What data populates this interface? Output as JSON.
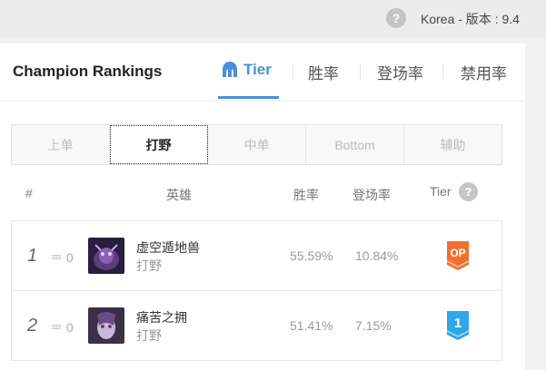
{
  "topbar": {
    "help_icon": "question-circle-icon",
    "region_text": "Korea - 版本 : 9.4"
  },
  "header": {
    "title": "Champion Rankings",
    "tabs": [
      {
        "label": "Tier",
        "icon": "helmet-icon",
        "active": true
      },
      {
        "label": "胜率"
      },
      {
        "label": "登场率"
      },
      {
        "label": "禁用率"
      }
    ]
  },
  "positions": [
    {
      "label": "上单"
    },
    {
      "label": "打野",
      "active": true
    },
    {
      "label": "中单"
    },
    {
      "label": "Bottom"
    },
    {
      "label": "辅助"
    }
  ],
  "table": {
    "headers": {
      "rank": "#",
      "champion": "英雄",
      "winrate": "胜率",
      "pickrate": "登场率",
      "tier": "Tier"
    },
    "tier_help_icon": "question-circle-icon",
    "rows": [
      {
        "rank": "1",
        "change": "0",
        "name": "虚空遁地兽",
        "role": "打野",
        "winrate": "55.59%",
        "pickrate": "10.84%",
        "tier": "OP",
        "tier_color": "#f0712f",
        "portrait_color": "#3b2a4f"
      },
      {
        "rank": "2",
        "change": "0",
        "name": "痛苦之拥",
        "role": "打野",
        "winrate": "51.41%",
        "pickrate": "7.15%",
        "tier": "1",
        "tier_color": "#2fa6e8",
        "portrait_color": "#4a3c5a"
      }
    ]
  },
  "colors": {
    "accent": "#4a90d6"
  }
}
